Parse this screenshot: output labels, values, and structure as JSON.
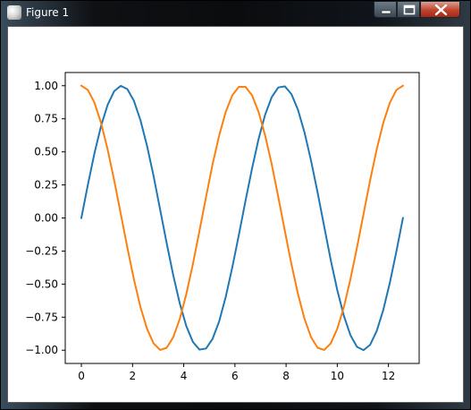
{
  "window": {
    "title": "Figure 1",
    "app_icon": "matplotlib-figure-icon",
    "buttons": {
      "minimize_icon": "minimize-icon",
      "maximize_icon": "maximize-icon",
      "close_icon": "close-icon"
    }
  },
  "colors": {
    "series_1": "#1f77b4",
    "series_2": "#ff7f0e",
    "background": "#ffffff",
    "axes": "#000000"
  },
  "chart_data": {
    "type": "line",
    "title": "",
    "xlabel": "",
    "ylabel": "",
    "xlim": [
      -0.63,
      13.2
    ],
    "ylim": [
      -1.1,
      1.1
    ],
    "grid": false,
    "legend": "none",
    "xticks": [
      0,
      2,
      4,
      6,
      8,
      10,
      12
    ],
    "xtick_labels": [
      "0",
      "2",
      "4",
      "6",
      "8",
      "10",
      "12"
    ],
    "yticks": [
      1.0,
      0.75,
      0.5,
      0.25,
      0.0,
      -0.25,
      -0.5,
      -0.75,
      -1.0
    ],
    "ytick_labels": [
      "1.00",
      "0.75",
      "0.50",
      "0.25",
      "0.00",
      "−0.25",
      "−0.50",
      "−0.75",
      "−1.00"
    ],
    "series": [
      {
        "color": "#1f77b4",
        "x": [
          0,
          0.2565,
          0.5129,
          0.7694,
          1.0258,
          1.2823,
          1.5387,
          1.7952,
          2.0517,
          2.3081,
          2.5646,
          2.821,
          3.0775,
          3.3339,
          3.5904,
          3.8468,
          4.1033,
          4.3598,
          4.6162,
          4.8727,
          5.1291,
          5.3856,
          5.642,
          5.8985,
          6.1549,
          6.4114,
          6.6679,
          6.9243,
          7.1808,
          7.4372,
          7.6937,
          7.9501,
          8.2066,
          8.463,
          8.7195,
          8.976,
          9.2324,
          9.4889,
          9.7453,
          10.0018,
          10.2582,
          10.5147,
          10.7711,
          11.0276,
          11.2841,
          11.5405,
          11.797,
          12.0534,
          12.3099,
          12.5664
        ],
        "values": [
          0.0,
          0.2537,
          0.4907,
          0.6957,
          0.8551,
          0.9587,
          0.9995,
          0.9749,
          0.8865,
          0.7403,
          0.5466,
          0.3187,
          0.0641,
          -0.1912,
          -0.4328,
          -0.6471,
          -0.8191,
          -0.9377,
          -0.9955,
          -0.9871,
          -0.9132,
          -0.7813,
          -0.5967,
          -0.3729,
          -0.1277,
          0.1277,
          0.3729,
          0.5967,
          0.7813,
          0.9132,
          0.9871,
          0.9955,
          0.9377,
          0.8191,
          0.6471,
          0.4328,
          0.1912,
          -0.0641,
          -0.3187,
          -0.5466,
          -0.7403,
          -0.8865,
          -0.9749,
          -0.9995,
          -0.9587,
          -0.8551,
          -0.6957,
          -0.4907,
          -0.2537,
          0.0
        ]
      },
      {
        "color": "#ff7f0e",
        "x": [
          0,
          0.2565,
          0.5129,
          0.7694,
          1.0258,
          1.2823,
          1.5387,
          1.7952,
          2.0517,
          2.3081,
          2.5646,
          2.821,
          3.0775,
          3.3339,
          3.5904,
          3.8468,
          4.1033,
          4.3598,
          4.6162,
          4.8727,
          5.1291,
          5.3856,
          5.642,
          5.8985,
          6.1549,
          6.4114,
          6.6679,
          6.9243,
          7.1808,
          7.4372,
          7.6937,
          7.9501,
          8.2066,
          8.463,
          8.7195,
          8.976,
          9.2324,
          9.4889,
          9.7453,
          10.0018,
          10.2582,
          10.5147,
          10.7711,
          11.0276,
          11.2841,
          11.5405,
          11.797,
          12.0534,
          12.3099,
          12.5664
        ],
        "values": [
          1.0,
          0.9673,
          0.8713,
          0.7185,
          0.5184,
          0.2845,
          0.0321,
          -0.2225,
          -0.4625,
          -0.6727,
          -0.8374,
          -0.9479,
          -0.9979,
          -0.9816,
          -0.9015,
          -0.7626,
          -0.5736,
          -0.3475,
          -0.0962,
          0.1596,
          0.4081,
          0.6242,
          0.8023,
          0.9279,
          0.9918,
          0.9918,
          0.9279,
          0.8023,
          0.6242,
          0.4081,
          0.1596,
          -0.0962,
          -0.3475,
          -0.5736,
          -0.7626,
          -0.9015,
          -0.9816,
          -0.9979,
          -0.9479,
          -0.8374,
          -0.6727,
          -0.4625,
          -0.2225,
          0.0321,
          0.2845,
          0.5184,
          0.7185,
          0.8713,
          0.9673,
          1.0
        ]
      }
    ]
  }
}
